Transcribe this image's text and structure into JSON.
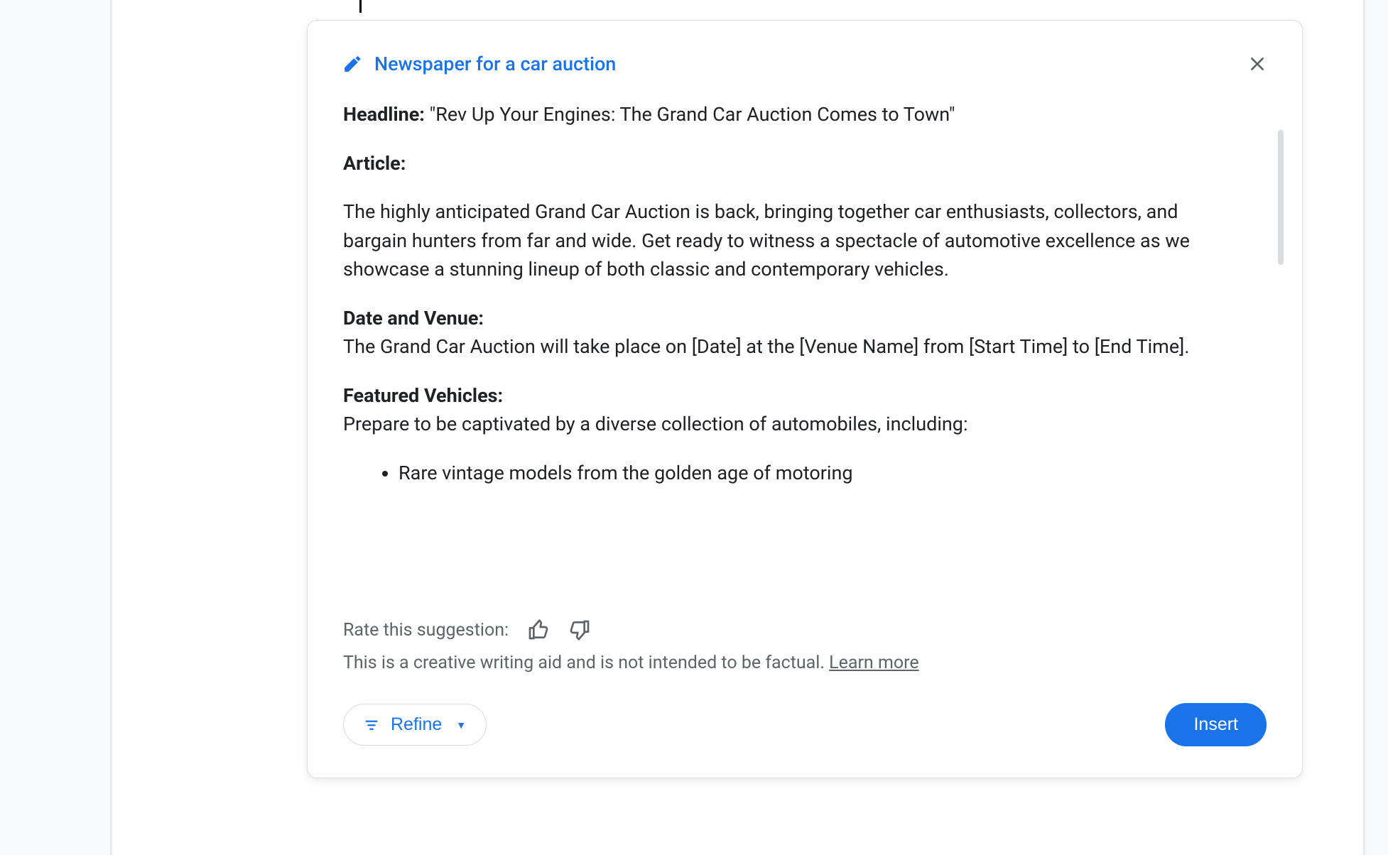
{
  "card": {
    "title": "Newspaper for a car auction",
    "content": {
      "headline_label": "Headline:",
      "headline_text": " \"Rev Up Your Engines: The Grand Car Auction Comes to Town\"",
      "article_label": "Article:",
      "article_p1": "The highly anticipated Grand Car Auction is back, bringing together car enthusiasts, collectors, and bargain hunters from far and wide. Get ready to witness a spectacle of automotive excellence as we showcase a stunning lineup of both classic and contemporary vehicles.",
      "date_venue_label": "Date and Venue:",
      "date_venue_text": "The Grand Car Auction will take place on [Date] at the [Venue Name] from [Start Time] to [End Time].",
      "featured_label": "Featured Vehicles:",
      "featured_intro": "Prepare to be captivated by a diverse collection of automobiles, including:",
      "featured_items": {
        "0": "Rare vintage models from the golden age of motoring"
      }
    },
    "footer": {
      "rate_label": "Rate this suggestion:",
      "disclaimer_text": "This is a creative writing aid and is not intended to be factual. ",
      "learn_more": "Learn more",
      "refine_label": "Refine",
      "insert_label": "Insert"
    }
  }
}
